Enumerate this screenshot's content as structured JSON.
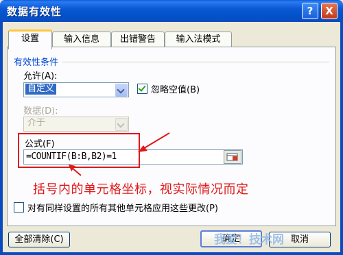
{
  "dialog": {
    "title": "数据有效性",
    "help_glyph": "?",
    "close_glyph": "X"
  },
  "tabs": [
    {
      "label": "设置",
      "active": true
    },
    {
      "label": "输入信息",
      "active": false
    },
    {
      "label": "出错警告",
      "active": false
    },
    {
      "label": "输入法模式",
      "active": false
    }
  ],
  "settings": {
    "group_header": "有效性条件",
    "allow_label": "允许(A):",
    "allow_value": "自定义",
    "ignore_blank_label": "忽略空值(B)",
    "ignore_blank_checked": true,
    "data_label": "数据(D):",
    "data_value": "介于",
    "formula_label": "公式(F)",
    "formula_value": "=COUNTIF(B:B,B2)=1",
    "apply_all_label": "对有同样设置的所有其他单元格应用这些更改(P)",
    "apply_all_checked": false
  },
  "annotation": {
    "text": "括号内的单元格坐标，视实际情况而定",
    "color": "#e01818"
  },
  "buttons": {
    "clear_all": "全部清除(C)",
    "ok": "确定",
    "cancel": "取消"
  },
  "watermark": "我爱！技术网"
}
